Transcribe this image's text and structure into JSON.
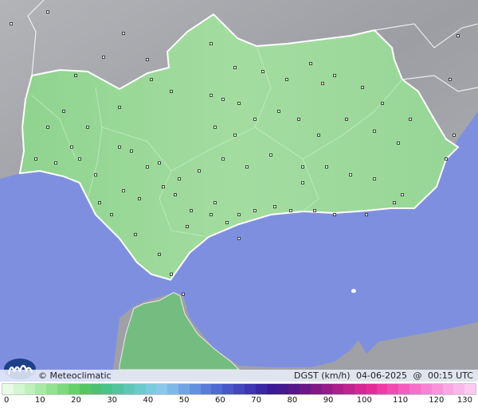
{
  "brand": {
    "name": "© Meteoclimatic"
  },
  "parameter": {
    "label": "DGST (km/h)",
    "date": "04-06-2025",
    "separator": "@",
    "time": "00:15 UTC"
  },
  "legend": {
    "ticks": [
      "0",
      "10",
      "20",
      "30",
      "40",
      "50",
      "60",
      "70",
      "80",
      "90",
      "100",
      "110",
      "120",
      "130"
    ],
    "colors": [
      "#e8fbe6",
      "#d4f6d2",
      "#bff0bd",
      "#a9e9a8",
      "#93e193",
      "#7cd97e",
      "#66d06c",
      "#55c764",
      "#4cc175",
      "#48c48a",
      "#52c5a0",
      "#5fc7b6",
      "#6cc9cc",
      "#7acbe0",
      "#8ac7ea",
      "#7fb8e8",
      "#70a5e4",
      "#6491df",
      "#597dd9",
      "#4f6ad2",
      "#4858ca",
      "#4347bf",
      "#3f36b3",
      "#3b27a5",
      "#3a1a98",
      "#44188f",
      "#57178a",
      "#6b1787",
      "#801886",
      "#961b88",
      "#ab1e8b",
      "#c0228f",
      "#d52693",
      "#e52a98",
      "#ee3aa2",
      "#f24bb0",
      "#f45dbd",
      "#f66fc9",
      "#f781d3",
      "#f893dc",
      "#f9a6e3",
      "#fab8ea",
      "#fbcaf0"
    ],
    "unit": "km/h"
  },
  "map_colors": {
    "sea": "#7f8fdf",
    "land_grey": "#a8aaae",
    "andalucia": "#9ad99a",
    "morocco": "#6fba7c",
    "border": "#ffffff"
  }
}
